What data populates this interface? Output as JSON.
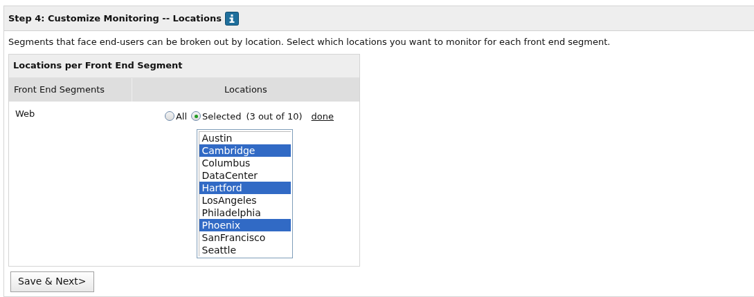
{
  "step_title": "Step 4: Customize Monitoring -- Locations",
  "description": "Segments that face end-users can be broken out by location. Select which locations you want to monitor for each front end segment.",
  "table": {
    "title": "Locations per Front End Segment",
    "columns": [
      "Front End Segments",
      "Locations"
    ],
    "rows": [
      {
        "segment": "Web",
        "options": [
          {
            "label": "All",
            "selected": false
          },
          {
            "label": "Selected",
            "selected": true
          }
        ],
        "count": "(3 out of 10)",
        "link": "done",
        "locations": [
          {
            "name": "Austin",
            "selected": false
          },
          {
            "name": "Cambridge",
            "selected": true
          },
          {
            "name": "Columbus",
            "selected": false
          },
          {
            "name": "DataCenter",
            "selected": false
          },
          {
            "name": "Hartford",
            "selected": true
          },
          {
            "name": "LosAngeles",
            "selected": false
          },
          {
            "name": "Philadelphia",
            "selected": false
          },
          {
            "name": "Phoenix",
            "selected": true
          },
          {
            "name": "SanFrancisco",
            "selected": false
          },
          {
            "name": "Seattle",
            "selected": false
          }
        ]
      }
    ]
  },
  "save_button": "Save & Next>"
}
